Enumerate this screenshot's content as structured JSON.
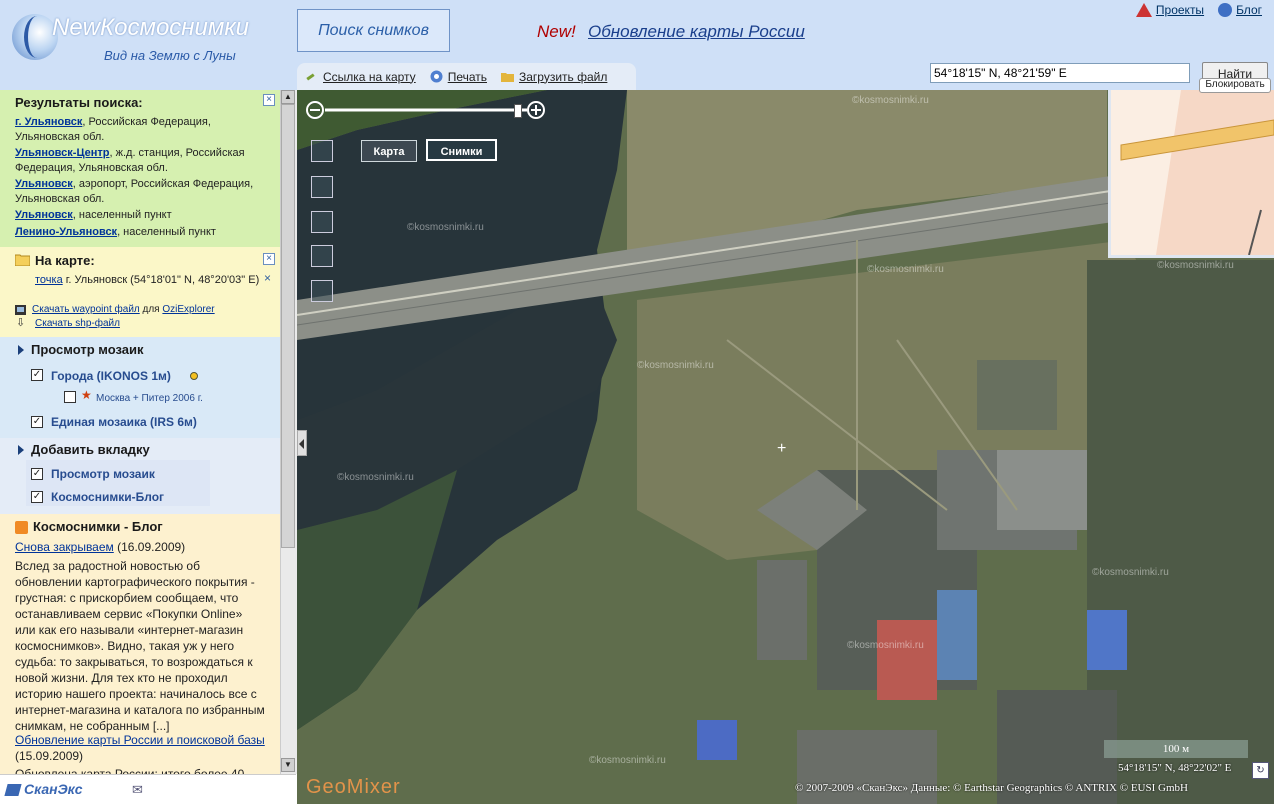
{
  "header": {
    "logo_title_new": "New",
    "logo_title": "Космоснимки",
    "logo_subtitle": "Вид на Землю с Луны",
    "search_button": "Поиск снимков",
    "news_new": "New!",
    "news_link": "Обновление карты России",
    "projects": "Проекты",
    "blog": "Блог",
    "toolbar": {
      "link": "Ссылка на карту",
      "print": "Печать",
      "upload": "Загрузить файл"
    },
    "coords_value": "54°18'15\" N, 48°21'59\" E",
    "find_button": "Найти",
    "block_label": "Блокировать"
  },
  "sidebar": {
    "results": {
      "title": "Результаты поиска:",
      "items": [
        {
          "name": "г. Ульяновск",
          "desc": ", Российская Федерация, Ульяновская обл."
        },
        {
          "name": "Ульяновск-Центр",
          "desc": ", ж.д. станция, Российская Федерация, Ульяновская обл."
        },
        {
          "name": "Ульяновск",
          "desc": ", аэропорт, Российская Федерация, Ульяновская обл."
        },
        {
          "name": "Ульяновск",
          "desc": ", населенный пункт"
        },
        {
          "name": "Ленино-Ульяновск",
          "desc": ", населенный пункт"
        }
      ]
    },
    "onmap": {
      "title": "На карте:",
      "point_link": "точка",
      "point_desc": "г. Ульяновск (54°18'01\" N, 48°20'03\" E)",
      "download_waypoint": "Скачать waypoint файл",
      "for_text": "для",
      "ozi": "OziExplorer",
      "download_shp": "Скачать shp-файл"
    },
    "mosaic": {
      "title": "Просмотр мозаик",
      "items": [
        {
          "label": "Города (IKONOS 1м)",
          "checked": true
        },
        {
          "label": "Москва + Питер 2006 г.",
          "checked": false
        },
        {
          "label": "Единая мозаика (IRS 6м)",
          "checked": true
        }
      ]
    },
    "addtab": {
      "title": "Добавить вкладку",
      "items": [
        {
          "label": "Просмотр мозаик",
          "checked": true
        },
        {
          "label": "Космоснимки-Блог",
          "checked": true
        }
      ]
    },
    "blog": {
      "title": "Космоснимки - Блог",
      "post1_title": "Снова закрываем",
      "post1_date": "(16.09.2009)",
      "post1_text": "Вслед за радостной новостью об обновлении картографического покрытия - грустная: с прискорбием сообщаем, что останавливаем сервис «Покупки Online» или как его называли «интернет-магазин космоснимков». Видно, такая уж у него судьба: то закрываться, то возрождаться к новой жизни. Для тех кто не проходил историю нашего проекта: начиналось все с интернет-магазина и каталога по избранным снимкам, не собранным [...]",
      "post2_title": "Обновление карты России и поисковой базы",
      "post2_date": "(15.09.2009)",
      "post2_text": "Обновлена карта России: итого более 40"
    },
    "footer_brand": "СканЭкс"
  },
  "map": {
    "type_map": "Карта",
    "type_sat": "Снимки",
    "watermark": "©kosmosnimki.ru",
    "scale": "100 м",
    "cursor_coords": "54°18'15\" N, 48°22'02\" E",
    "copyright": "© 2007-2009 «СканЭкс»  Данные: © Earthstar Geographics  © ANTRIX  © EUSI GmbH",
    "geomixer": "GeoMixer",
    "zoom_level": 0.95
  },
  "colors": {
    "header_bg": "#cfe0f7",
    "results_bg": "#d6f0b0",
    "onmap_bg": "#fbf7c8",
    "mosaic_bg": "#d9e9f7",
    "blog_bg": "#fdf1cf",
    "link": "#003399"
  }
}
